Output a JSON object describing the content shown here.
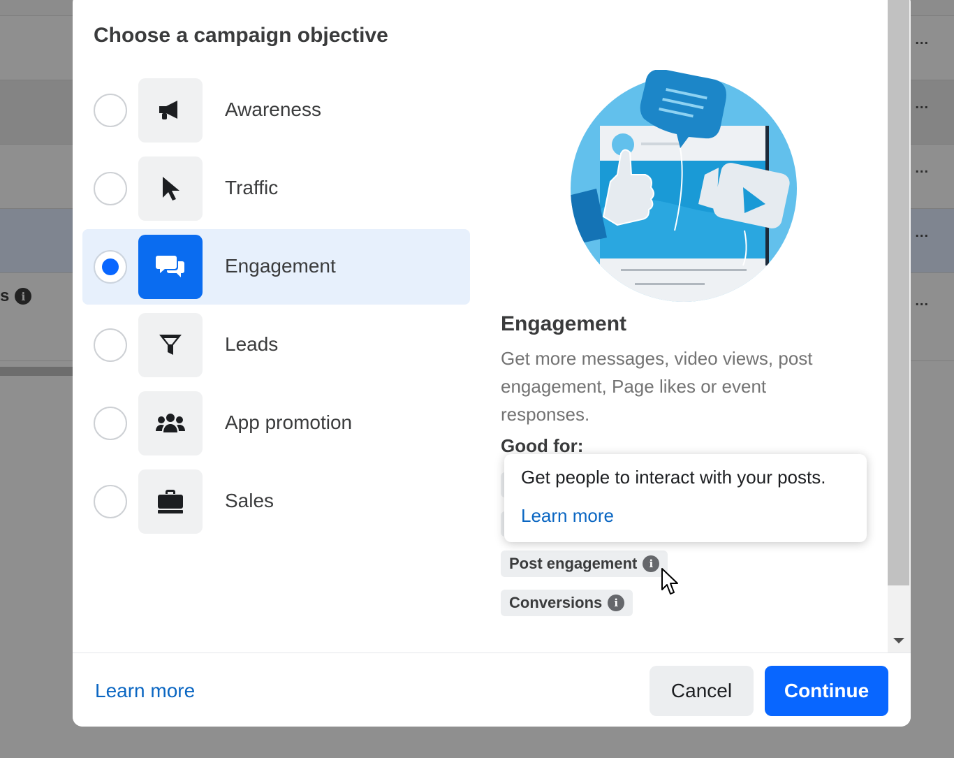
{
  "background": {
    "row_label": "s",
    "row_menu": "..."
  },
  "modal": {
    "title": "Choose a campaign objective",
    "options": [
      {
        "label": "Awareness",
        "icon": "megaphone-icon",
        "selected": false
      },
      {
        "label": "Traffic",
        "icon": "cursor-icon",
        "selected": false
      },
      {
        "label": "Engagement",
        "icon": "chat-bubbles-icon",
        "selected": true
      },
      {
        "label": "Leads",
        "icon": "funnel-icon",
        "selected": false
      },
      {
        "label": "App promotion",
        "icon": "people-icon",
        "selected": false
      },
      {
        "label": "Sales",
        "icon": "briefcase-icon",
        "selected": false
      }
    ],
    "detail": {
      "title": "Engagement",
      "description": "Get more messages, video views, post engagement, Page likes or event responses.",
      "good_for_label": "Good for:",
      "tags": [
        "Post engagement",
        "Conversions"
      ]
    },
    "tooltip": {
      "text": "Get people to interact with your posts.",
      "link": "Learn more"
    },
    "footer": {
      "learn_more": "Learn more",
      "cancel": "Cancel",
      "continue": "Continue"
    }
  },
  "colors": {
    "accent": "#0866ff",
    "selected_bg": "#e7f0fc",
    "link": "#0a66c2"
  }
}
